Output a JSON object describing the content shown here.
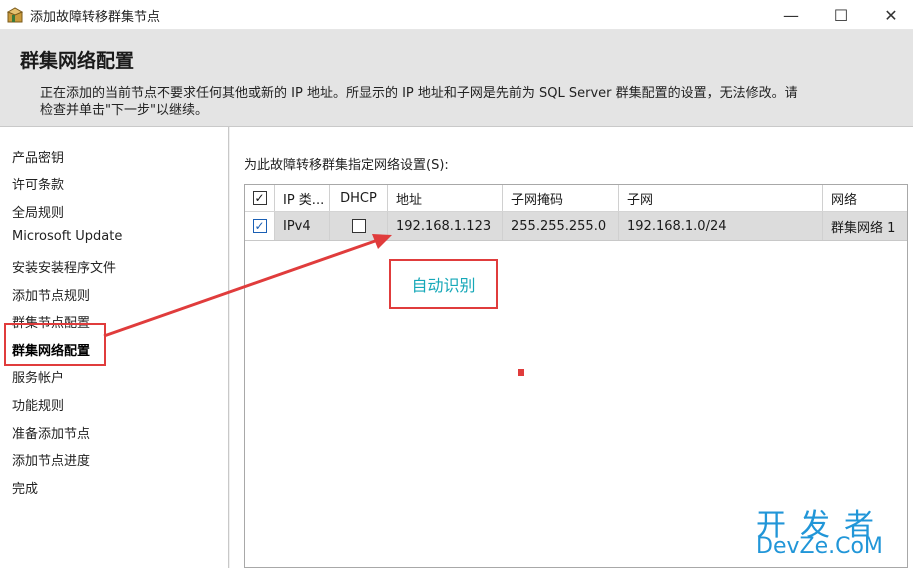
{
  "window": {
    "title": "添加故障转移群集节点",
    "icon": "package-icon",
    "minimize": "—",
    "maximize": "☐",
    "close": "✕"
  },
  "header": {
    "title": "群集网络配置",
    "description": "正在添加的当前节点不要求任何其他或新的 IP 地址。所显示的 IP 地址和子网是先前为 SQL Server 群集配置的设置，无法修改。请检查并单击\"下一步\"以继续。"
  },
  "sidebar": {
    "items": [
      {
        "label": "产品密钥",
        "active": false
      },
      {
        "label": "许可条款",
        "active": false
      },
      {
        "label": "全局规则",
        "active": false
      },
      {
        "label": "Microsoft Update",
        "active": false
      },
      {
        "label": "安装安装程序文件",
        "active": false
      },
      {
        "label": "添加节点规则",
        "active": false
      },
      {
        "label": "群集节点配置",
        "active": false
      },
      {
        "label": "群集网络配置",
        "active": true
      },
      {
        "label": "服务帐户",
        "active": false
      },
      {
        "label": "功能规则",
        "active": false
      },
      {
        "label": "准备添加节点",
        "active": false
      },
      {
        "label": "添加节点进度",
        "active": false
      },
      {
        "label": "完成",
        "active": false
      }
    ]
  },
  "main": {
    "section_label": "为此故障转移群集指定网络设置(S):",
    "grid": {
      "columns": [
        "",
        "IP 类...",
        "DHCP",
        "地址",
        "子网掩码",
        "子网",
        "网络"
      ],
      "rows": [
        {
          "selected": true,
          "ip_type": "IPv4",
          "dhcp": false,
          "address": "192.168.1.123",
          "subnet_mask": "255.255.255.0",
          "subnet": "192.168.1.0/24",
          "network": "群集网络 1"
        }
      ]
    }
  },
  "annotation": {
    "text": "自动识别",
    "color": "#e03c3c",
    "text_color": "#16a8b8"
  },
  "watermark": {
    "cn": "开发者",
    "en": "DevZe.CoM",
    "color": "#2196d8"
  }
}
